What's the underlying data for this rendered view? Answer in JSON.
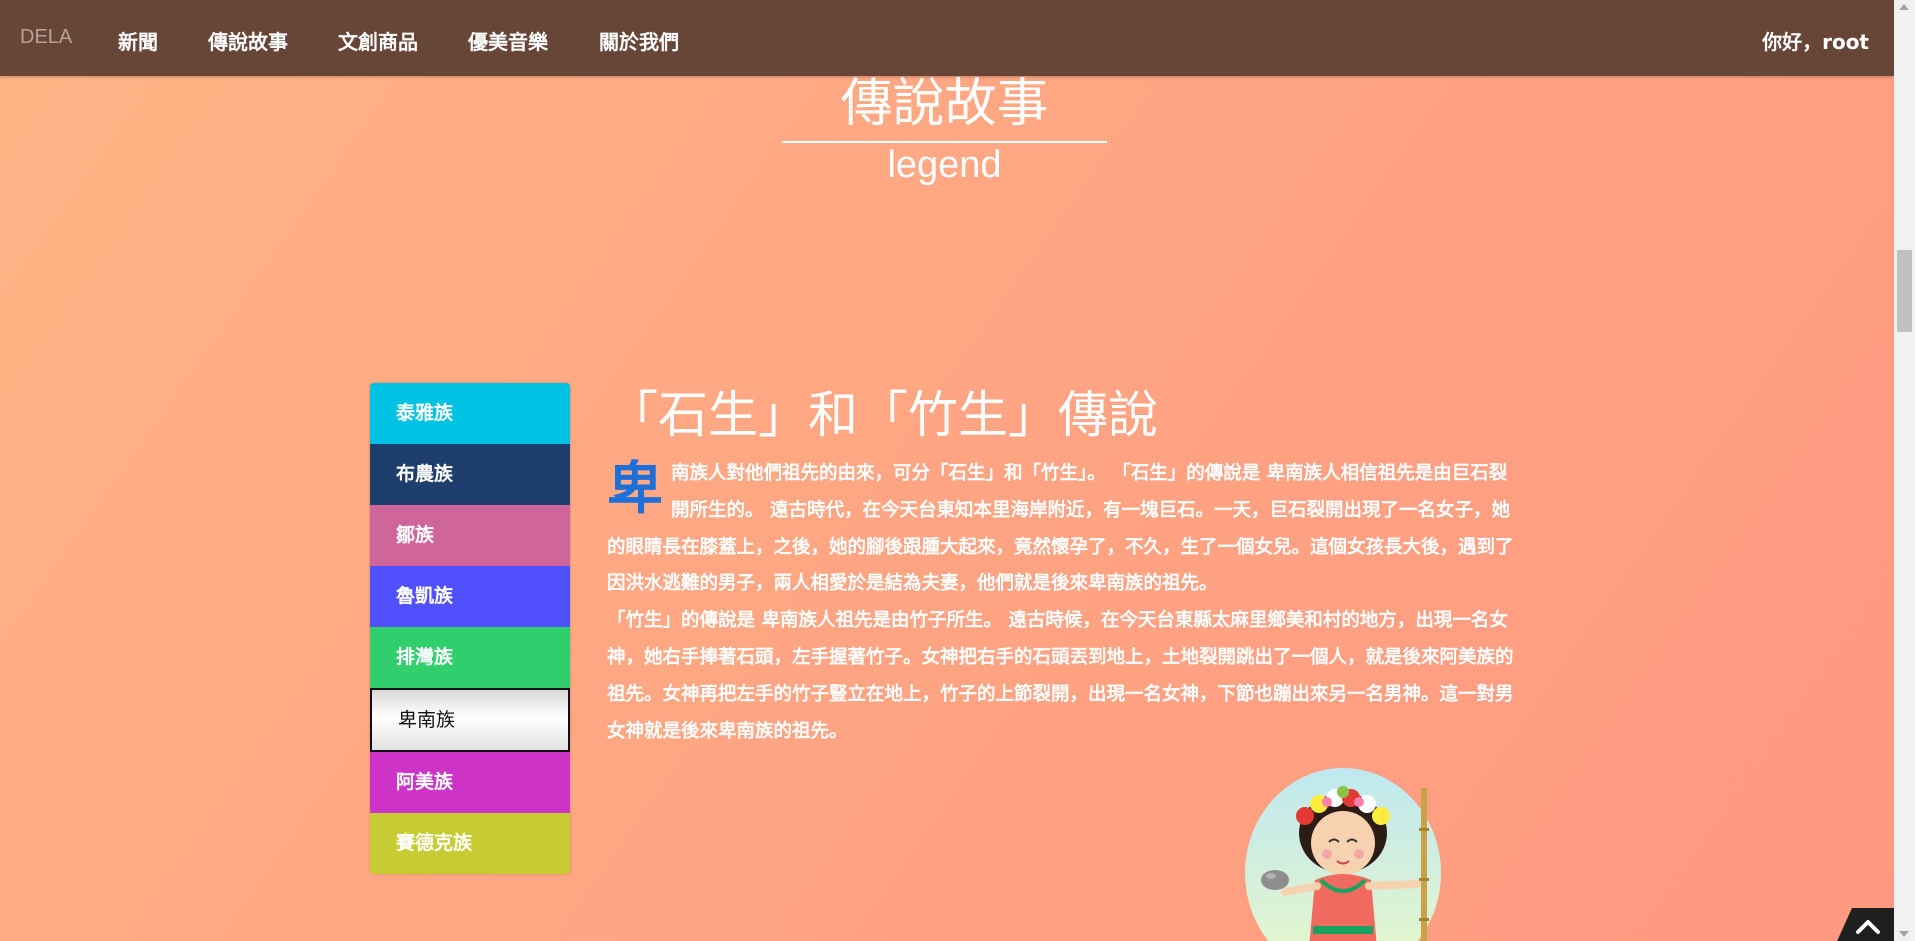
{
  "navbar": {
    "brand": "DELA",
    "items": [
      {
        "label": "新聞"
      },
      {
        "label": "傳說故事"
      },
      {
        "label": "文創商品"
      },
      {
        "label": "優美音樂"
      },
      {
        "label": "關於我們"
      }
    ],
    "greeting": "你好，root"
  },
  "header": {
    "title": "傳說故事",
    "subtitle": "legend"
  },
  "tribes": [
    {
      "label": "泰雅族",
      "color": "#00c2e2"
    },
    {
      "label": "布農族",
      "color": "#1e3f6e"
    },
    {
      "label": "鄒族",
      "color": "#cf659a"
    },
    {
      "label": "魯凱族",
      "color": "#5050ff"
    },
    {
      "label": "排灣族",
      "color": "#30ce6d"
    },
    {
      "label": "卑南族",
      "color": "#f0f0f0",
      "active": true
    },
    {
      "label": "阿美族",
      "color": "#cc33c6"
    },
    {
      "label": "賽德克族",
      "color": "#c8cc33"
    }
  ],
  "story": {
    "title": "「石生」和「竹生」傳說",
    "drop_cap": "卑",
    "paragraph1": "南族人對他們祖先的由來，可分「石生」和「竹生」。 「石生」的傳說是 卑南族人相信祖先是由巨石裂開所生的。 遠古時代，在今天台東知本里海岸附近，有一塊巨石。一天，巨石裂開出現了一名女子，她的眼睛長在膝蓋上，之後，她的腳後跟腫大起來，竟然懷孕了，不久，生了一個女兒。這個女孩長大後，遇到了因洪水逃難的男子，兩人相愛於是結為夫妻，他們就是後來卑南族的祖先。",
    "paragraph2": "「竹生」的傳說是 卑南族人祖先是由竹子所生。 遠古時候，在今天台東縣太麻里鄉美和村的地方，出現一名女神，她右手捧著石頭，左手握著竹子。女神把右手的石頭丟到地上，土地裂開跳出了一個人，就是後來阿美族的祖先。女神再把左手的竹子豎立在地上，竹子的上節裂開，出現一名女神，下節也蹦出來另一名男神。這一對男女神就是後來卑南族的祖先。"
  },
  "colors": {
    "navbar": "#674537",
    "drop_cap": "#1f6fd8",
    "background_start": "#ffb485",
    "background_end": "#ff9880"
  },
  "icons": {
    "back_to_top": "chevron-up-icon"
  }
}
